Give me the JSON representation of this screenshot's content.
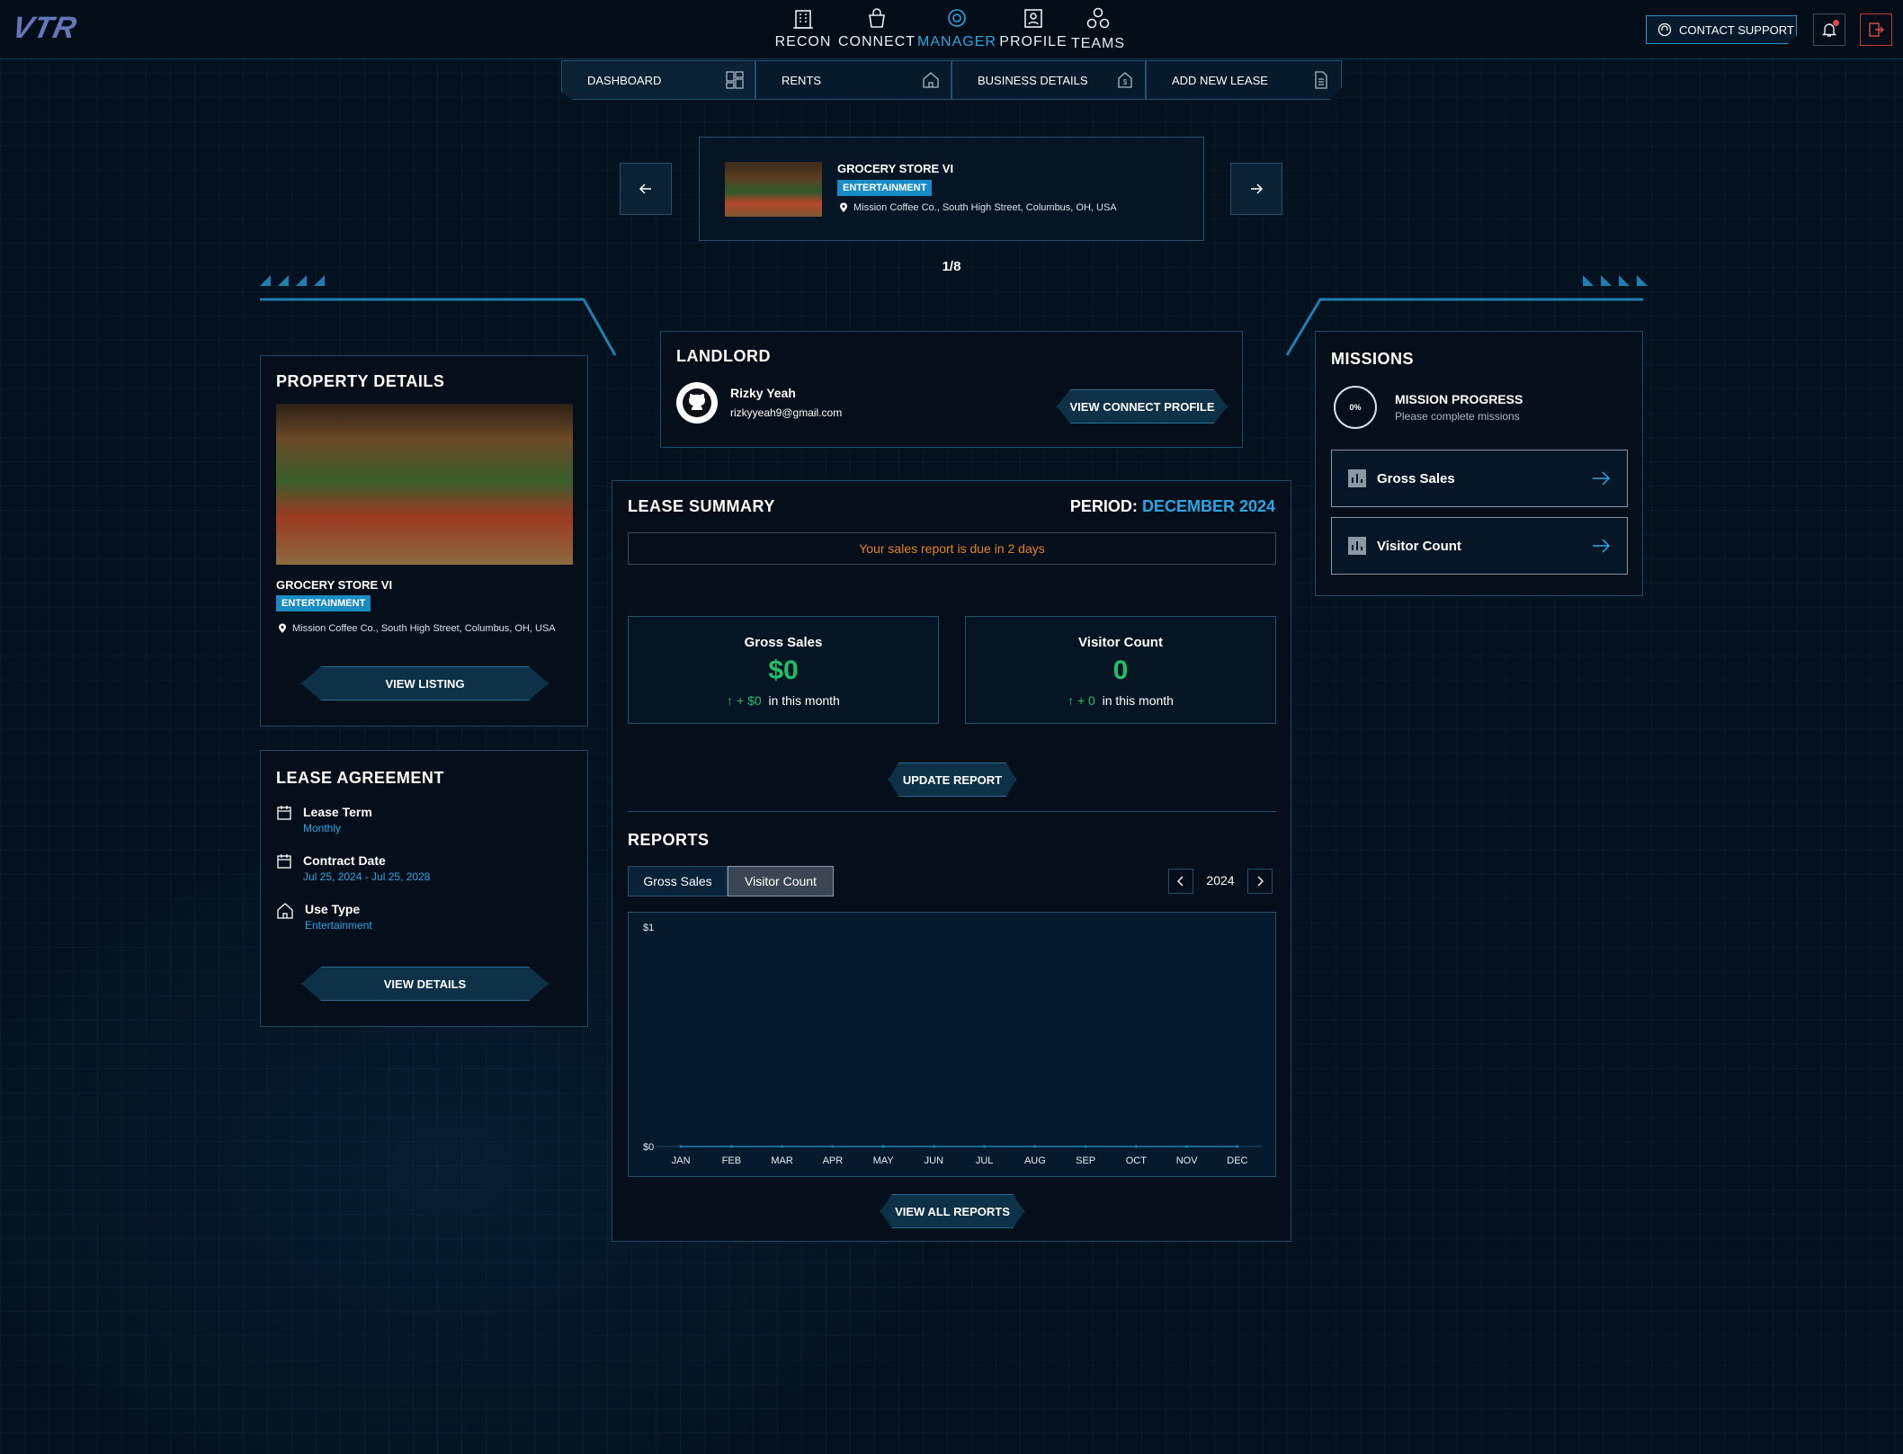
{
  "header": {
    "logo": "VTR",
    "nav": [
      {
        "label": "RECON",
        "icon": "building-icon"
      },
      {
        "label": "CONNECT",
        "icon": "bag-icon"
      },
      {
        "label": "MANAGER",
        "icon": "gear-icon",
        "active": true
      },
      {
        "label": "PROFILE",
        "icon": "profile-icon"
      },
      {
        "label": "TEAMS",
        "icon": "team-icon"
      }
    ],
    "contact_support": "CONTACT SUPPORT"
  },
  "subnav": {
    "tabs": [
      {
        "label": "DASHBOARD",
        "active": true
      },
      {
        "label": "RENTS"
      },
      {
        "label": "BUSINESS DETAILS"
      },
      {
        "label": "ADD NEW LEASE"
      }
    ]
  },
  "carousel": {
    "title": "GROCERY STORE VI",
    "tag": "ENTERTAINMENT",
    "address": "Mission Coffee Co., South High Street, Columbus, OH, USA",
    "counter": "1/8"
  },
  "property": {
    "heading": "PROPERTY DETAILS",
    "name": "GROCERY STORE VI",
    "tag": "ENTERTAINMENT",
    "address": "Mission Coffee Co., South High Street, Columbus, OH, USA",
    "button": "VIEW LISTING"
  },
  "lease_agreement": {
    "heading": "LEASE AGREEMENT",
    "term_label": "Lease Term",
    "term_value": "Monthly",
    "contract_label": "Contract Date",
    "contract_value": "Jul 25, 2024 - Jul 25, 2028",
    "use_label": "Use Type",
    "use_value": "Entertainment",
    "button": "VIEW DETAILS"
  },
  "landlord": {
    "heading": "LANDLORD",
    "name": "Rizky Yeah",
    "email": "rizkyyeah9@gmail.com",
    "button": "VIEW CONNECT PROFILE"
  },
  "lease_summary": {
    "heading": "LEASE SUMMARY",
    "period_label": "PERIOD:",
    "period_value": "DECEMBER 2024",
    "notice": "Your sales report is due in 2 days",
    "gross_title": "Gross Sales",
    "gross_value": "$0",
    "gross_delta": "+ $0",
    "visitor_title": "Visitor Count",
    "visitor_value": "0",
    "visitor_delta": "+ 0",
    "delta_suffix": "in this month",
    "update_button": "UPDATE REPORT",
    "reports_heading": "REPORTS",
    "tab_gross": "Gross Sales",
    "tab_visitor": "Visitor Count",
    "year": "2024",
    "view_all": "VIEW ALL REPORTS"
  },
  "missions": {
    "heading": "MISSIONS",
    "progress_pct": "0%",
    "progress_title": "MISSION PROGRESS",
    "progress_sub": "Please complete missions",
    "items": [
      "Gross Sales",
      "Visitor Count"
    ]
  },
  "chart_data": {
    "type": "line",
    "categories": [
      "JAN",
      "FEB",
      "MAR",
      "APR",
      "MAY",
      "JUN",
      "JUL",
      "AUG",
      "SEP",
      "OCT",
      "NOV",
      "DEC"
    ],
    "values": [
      0,
      0,
      0,
      0,
      0,
      0,
      0,
      0,
      0,
      0,
      0,
      0
    ],
    "y_tick_labels": [
      "$1",
      "$0"
    ],
    "ylim": [
      0,
      1
    ]
  },
  "colors": {
    "accent": "#2aa7e0",
    "positive": "#1fbf6a",
    "warning": "#e8821e",
    "background": "#04111e"
  }
}
